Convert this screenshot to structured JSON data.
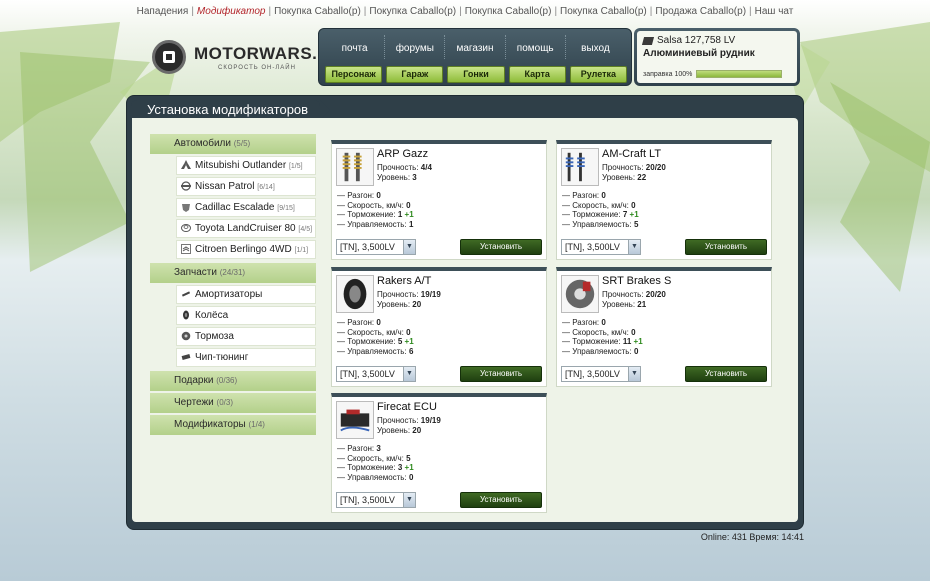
{
  "top_links": [
    "Нападения",
    "Модификатор",
    "Покупка Caballo(p)",
    "Покупка Caballo(p)",
    "Покупка Caballo(p)",
    "Покупка Caballo(p)",
    "Продажа Caballo(p)",
    "Наш чат"
  ],
  "top_links_active_index": 1,
  "logo": {
    "name": "MOTORWARS.RU",
    "tagline": "СКОРОСТЬ ОН-ЛАЙН"
  },
  "nav": {
    "primary": [
      "почта",
      "форумы",
      "магазин",
      "помощь",
      "выход"
    ],
    "secondary": [
      "Персонаж",
      "Гараж",
      "Гонки",
      "Карта",
      "Рулетка"
    ]
  },
  "user": {
    "name_money": "Salsa 127,758 LV",
    "location": "Алюминиевый рудник",
    "fuel_label": "заправка 100%",
    "fuel_level": 1.0
  },
  "main": {
    "title": "Установка модификаторов"
  },
  "sidebar": {
    "categories": [
      {
        "label": "Автомобили",
        "count": "(5/5)"
      },
      {
        "label": "Запчасти",
        "count": "(24/31)"
      },
      {
        "label": "Подарки",
        "count": "(0/36)"
      },
      {
        "label": "Чертежи",
        "count": "(0/3)"
      },
      {
        "label": "Модификаторы",
        "count": "(1/4)"
      }
    ],
    "cars": [
      {
        "label": "Mitsubishi Outlander",
        "count": "[1/5]"
      },
      {
        "label": "Nissan Patrol",
        "count": "[6/14]"
      },
      {
        "label": "Cadillac Escalade",
        "count": "[9/15]"
      },
      {
        "label": "Toyota LandCruiser 80",
        "count": "[4/5]"
      },
      {
        "label": "Citroen Berlingo 4WD",
        "count": "[1/1]"
      }
    ],
    "parts": [
      {
        "label": "Амортизаторы"
      },
      {
        "label": "Колёса"
      },
      {
        "label": "Тормоза"
      },
      {
        "label": "Чип-тюнинг"
      }
    ]
  },
  "labels": {
    "durability": "Прочность:",
    "level": "Уровень:",
    "accel": "— Разгон:",
    "speed": "— Скорость, км/ч:",
    "brake": "— Торможение:",
    "handling": "— Управляемость:",
    "install": "Установить"
  },
  "cards": [
    {
      "name": "ARP Gazz",
      "durability": "4/4",
      "level": "3",
      "accel": "0",
      "speed": "0",
      "brake": "1",
      "brake_plus": "+1",
      "handling": "1",
      "select": "[TN], 3,500LV"
    },
    {
      "name": "AM-Craft LT",
      "durability": "20/20",
      "level": "22",
      "accel": "0",
      "speed": "0",
      "brake": "7",
      "brake_plus": "+1",
      "handling": "5",
      "select": "[TN], 3,500LV"
    },
    {
      "name": "Rakers A/T",
      "durability": "19/19",
      "level": "20",
      "accel": "0",
      "speed": "0",
      "brake": "5",
      "brake_plus": "+1",
      "handling": "6",
      "select": "[TN], 3,500LV"
    },
    {
      "name": "SRT Brakes S",
      "durability": "20/20",
      "level": "21",
      "accel": "0",
      "speed": "0",
      "brake": "11",
      "brake_plus": "+1",
      "handling": "0",
      "select": "[TN], 3,500LV"
    },
    {
      "name": "Firecat ECU",
      "durability": "19/19",
      "level": "20",
      "accel": "3",
      "speed": "5",
      "brake": "3",
      "brake_plus": "+1",
      "handling": "0",
      "select": "[TN], 3,500LV"
    }
  ],
  "footer": {
    "online": "Online: 431",
    "time": "Время: 14:41"
  },
  "colors": {
    "accent_green": "#8fbc3a",
    "panel_dark": "#2f3f48",
    "plus_green": "#2e8a1e",
    "active_link": "#b2242a"
  }
}
